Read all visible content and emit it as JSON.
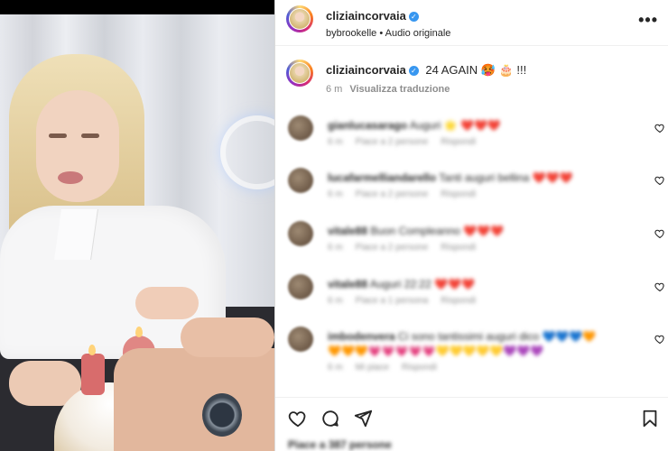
{
  "header": {
    "username": "cliziaincorvaia",
    "verified_glyph": "✓",
    "subtitle": "bybrookelle • Audio originale",
    "more_icon": "more-horizontal-icon",
    "more_glyph": "•••"
  },
  "caption": {
    "username": "cliziaincorvaia",
    "text": "24 AGAIN 🥵 🎂 !!!",
    "time": "6 m",
    "translate_label": "Visualizza traduzione"
  },
  "comments": [
    {
      "user": "gianlucasarago",
      "text": "Auguri 🌟 ❤️❤️❤️",
      "time": "6 m",
      "likes": "Piace a 2 persone",
      "reply": "Rispondi"
    },
    {
      "user": "lucafarmelliandarello",
      "text": "Tanti auguri bellina ❤️❤️❤️",
      "time": "6 m",
      "likes": "Piace a 2 persone",
      "reply": "Rispondi"
    },
    {
      "user": "vitale88",
      "text": "Buon Compleanno ❤️❤️❤️",
      "time": "6 m",
      "likes": "Piace a 2 persone",
      "reply": "Rispondi"
    },
    {
      "user": "vitale88",
      "text": "Auguri 22:22 ❤️❤️❤️",
      "time": "6 m",
      "likes": "Piace a 1 persona",
      "reply": "Rispondi"
    },
    {
      "user": "imbodenvera",
      "text": "Ci sono tantissimi auguri dico 💙💙💙🧡",
      "line2": "🧡🧡🧡💗💗💗💗💗💛💛💛💛💛💜💜💜",
      "time": "6 m",
      "likes": "Mi piace",
      "reply": "Rispondi"
    }
  ],
  "actions": {
    "like_icon": "heart-icon",
    "comment_icon": "comment-icon",
    "share_icon": "send-icon",
    "save_icon": "bookmark-icon"
  },
  "likes_summary": "Piace a 387 persone",
  "colors": {
    "verified": "#3897f0",
    "heart": "#ed4956",
    "muted": "#8e8e8e",
    "text": "#262626"
  }
}
